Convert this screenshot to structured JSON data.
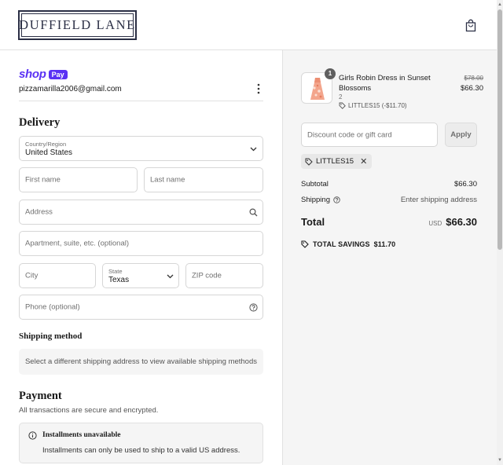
{
  "header": {
    "logo_text": "DUFFIELD LANE",
    "cart_icon": "shopping-bag-icon"
  },
  "colors": {
    "shop_pay_purple": "#5a31f4",
    "brand_navy": "#2b2f45",
    "summary_bg": "#f5f5f5"
  },
  "contact": {
    "shop_word": "shop",
    "pay_badge": "Pay",
    "email": "pizzamarilla2006@gmail.com"
  },
  "delivery": {
    "title": "Delivery",
    "country_label": "Country/Region",
    "country_value": "United States",
    "first_name_placeholder": "First name",
    "last_name_placeholder": "Last name",
    "address_placeholder": "Address",
    "apartment_placeholder": "Apartment, suite, etc. (optional)",
    "city_placeholder": "City",
    "state_label": "State",
    "state_value": "Texas",
    "zip_placeholder": "ZIP code",
    "phone_placeholder": "Phone (optional)"
  },
  "shipping_method": {
    "title": "Shipping method",
    "note": "Select a different shipping address to view available shipping methods"
  },
  "payment": {
    "title": "Payment",
    "subtitle": "All transactions are secure and encrypted.",
    "installments_title": "Installments unavailable",
    "installments_text": "Installments can only be used to ship to a valid US address."
  },
  "summary": {
    "item": {
      "quantity_badge": "1",
      "name": "Girls Robin Dress in Sunset Blossoms",
      "variant": "2",
      "discount_line": "LITTLES15 (-$11.70)",
      "price_original": "$78.00",
      "price_final": "$66.30"
    },
    "discount_placeholder": "Discount code or gift card",
    "apply_label": "Apply",
    "applied_code": "LITTLES15",
    "subtotal_label": "Subtotal",
    "subtotal_value": "$66.30",
    "shipping_label": "Shipping",
    "shipping_value": "Enter shipping address",
    "total_label": "Total",
    "currency": "USD",
    "total_value": "$66.30",
    "savings_label": "TOTAL SAVINGS",
    "savings_value": "$11.70"
  }
}
